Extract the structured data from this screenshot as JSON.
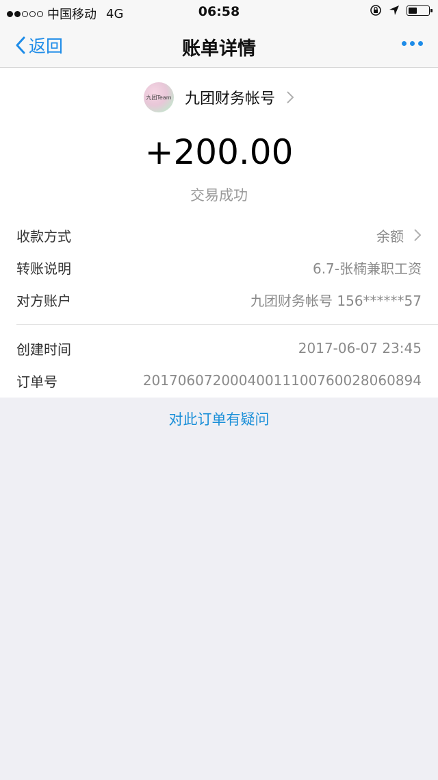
{
  "status_bar": {
    "carrier": "中国移动",
    "network": "4G",
    "time": "06:58"
  },
  "nav": {
    "back_label": "返回",
    "title": "账单详情"
  },
  "payee": {
    "avatar_text": "九团Team",
    "name": "九团财务帐号"
  },
  "amount": "+200.00",
  "status": "交易成功",
  "details": [
    {
      "label": "收款方式",
      "value": "余额"
    },
    {
      "label": "转账说明",
      "value": "6.7-张楠兼职工资"
    },
    {
      "label": "对方账户",
      "value": "九团财务帐号 156******57"
    },
    {
      "label": "创建时间",
      "value": "2017-06-07 23:45"
    },
    {
      "label": "订单号",
      "value": "20170607200040011100760028060894"
    }
  ],
  "question_link": "对此订单有疑问",
  "colors": {
    "accent": "#1e8ce8",
    "link": "#1a8fd8",
    "background": "#efeff4"
  },
  "icons": [
    "back-chevron-icon",
    "more-icon",
    "lock-rotation-icon",
    "location-arrow-icon",
    "battery-icon",
    "chevron-right-icon"
  ]
}
